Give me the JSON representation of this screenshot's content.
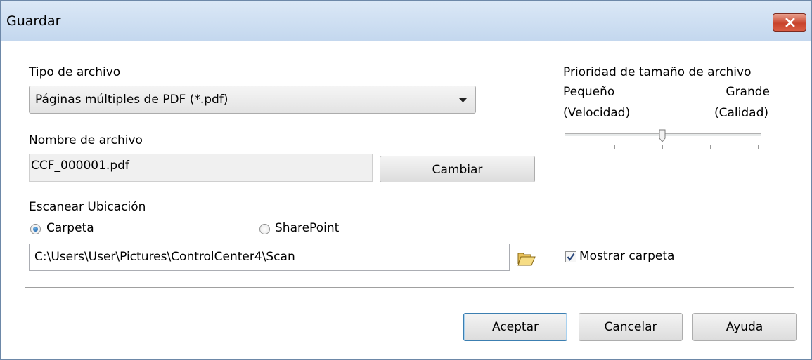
{
  "window": {
    "title": "Guardar"
  },
  "file_type": {
    "label": "Tipo de archivo",
    "selected": "Páginas múltiples de PDF (*.pdf)"
  },
  "file_name": {
    "label": "Nombre de archivo",
    "value": "CCF_000001.pdf",
    "change_button": "Cambiar"
  },
  "size_priority": {
    "title": "Prioridad de tamaño de archivo",
    "small_label": "Pequeño",
    "small_sub": "(Velocidad)",
    "large_label": "Grande",
    "large_sub": "(Calidad)",
    "level": 0.5,
    "ticks": 5
  },
  "scan_location": {
    "label": "Escanear Ubicación",
    "options": [
      {
        "label": "Carpeta",
        "selected": true
      },
      {
        "label": "SharePoint",
        "selected": false
      }
    ],
    "path": "C:\\Users\\User\\Pictures\\ControlCenter4\\Scan",
    "folder_icon": "folder-open-icon"
  },
  "show_folder": {
    "label": "Mostrar carpeta",
    "checked": true
  },
  "buttons": {
    "ok": "Aceptar",
    "cancel": "Cancelar",
    "help": "Ayuda"
  },
  "colors": {
    "accent": "#1b5aa0",
    "close": "#c8432c",
    "titlebar": "#c3d7ee"
  }
}
